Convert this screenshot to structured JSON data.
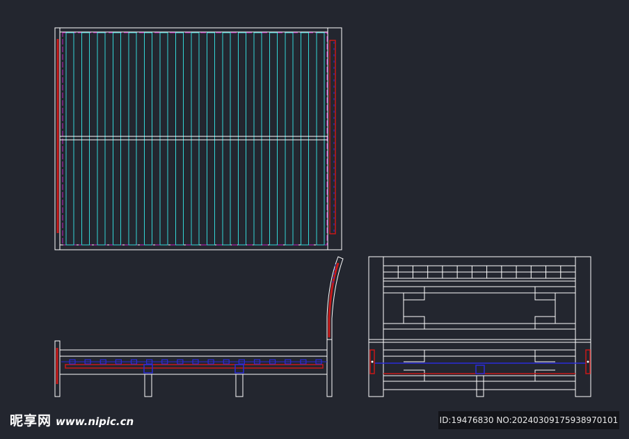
{
  "colors": {
    "background": "#23262f",
    "outline": "#ffffff",
    "slat": "#33d7d7",
    "centerline": "#2b2bd9",
    "accent_red": "#c81919",
    "accent_magenta": "#c020c0"
  },
  "drawing": {
    "views": [
      "top-view",
      "side-view",
      "front-view"
    ],
    "slat_count": 17,
    "side_slat_markers": 17
  },
  "watermark": {
    "site_name": "昵享网",
    "site_url": "www.nipic.cn",
    "id_text": "ID:19476830 NO:20240309175938970101"
  }
}
